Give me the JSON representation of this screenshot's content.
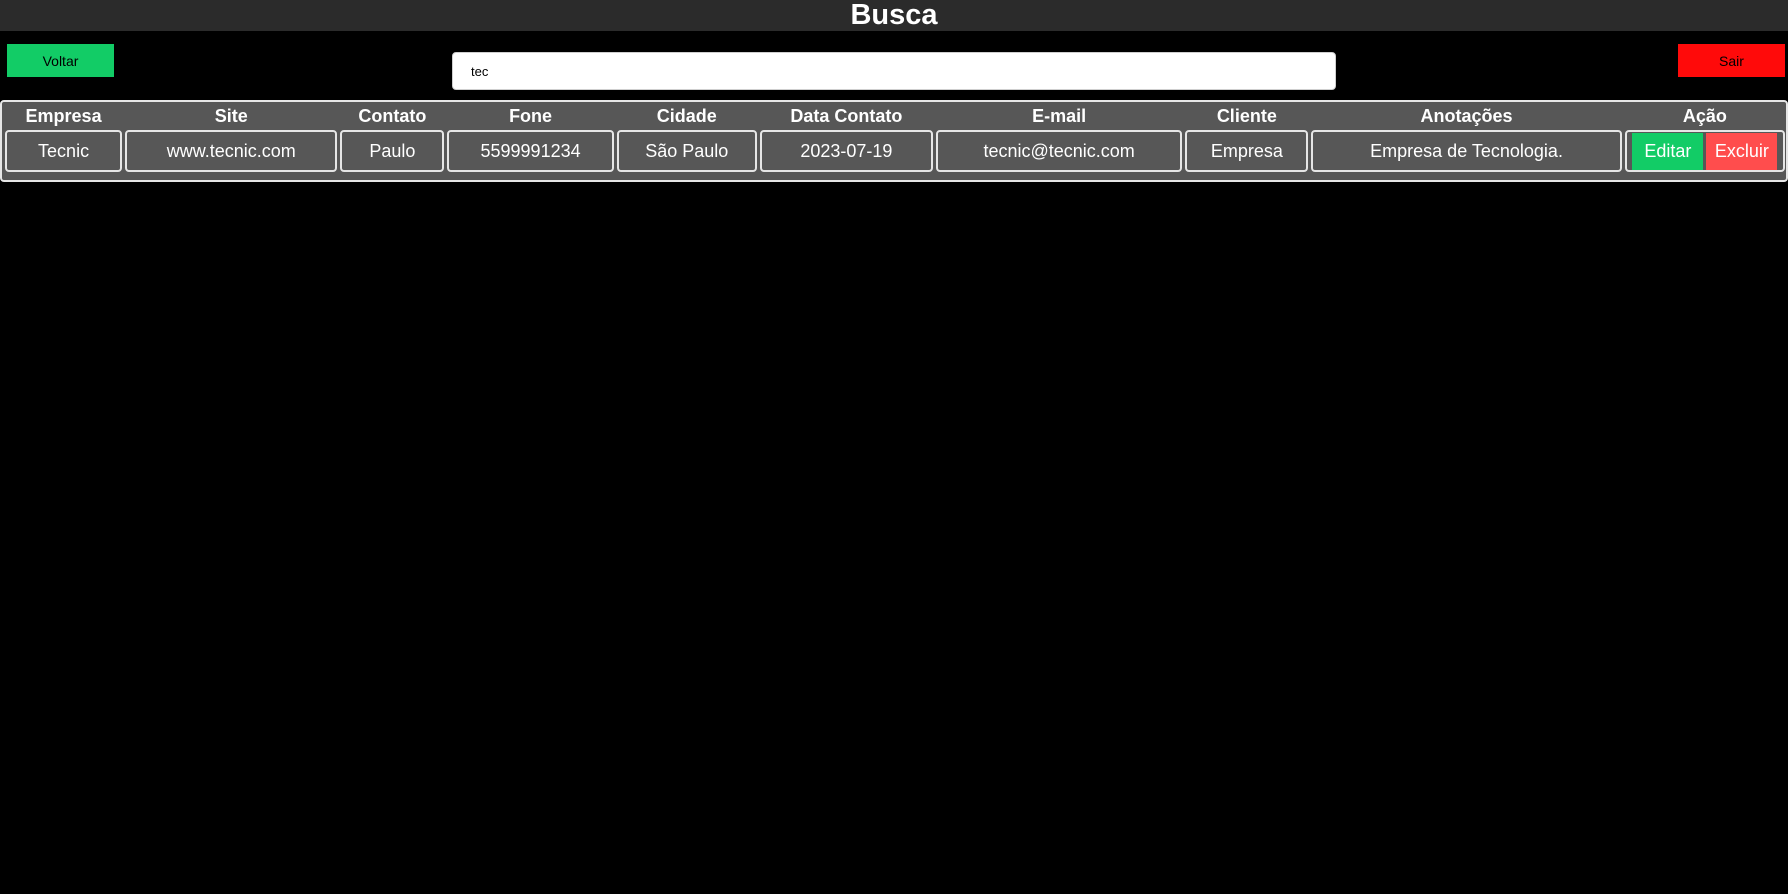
{
  "page": {
    "title": "Busca"
  },
  "nav": {
    "back_label": "Voltar",
    "exit_label": "Sair"
  },
  "search": {
    "value": "tec",
    "placeholder": ""
  },
  "table": {
    "headers": [
      "Empresa",
      "Site",
      "Contato",
      "Fone",
      "Cidade",
      "Data Contato",
      "E-mail",
      "Cliente",
      "Anotações",
      "Ação"
    ],
    "rows": [
      {
        "empresa": "Tecnic",
        "site": "www.tecnic.com",
        "contato": "Paulo",
        "fone": "5599991234",
        "cidade": "São Paulo",
        "data_contato": "2023-07-19",
        "email": "tecnic@tecnic.com",
        "cliente": "Empresa",
        "anotacoes": "Empresa de Tecnologia.",
        "edit_label": "Editar",
        "delete_label": "Excluir"
      }
    ]
  },
  "colors": {
    "background": "#000000",
    "title_bar": "#2b2b2b",
    "table_bg": "#575757",
    "green": "#12cc66",
    "red": "#ff0a0a",
    "delete_red": "#ff4d4d"
  }
}
